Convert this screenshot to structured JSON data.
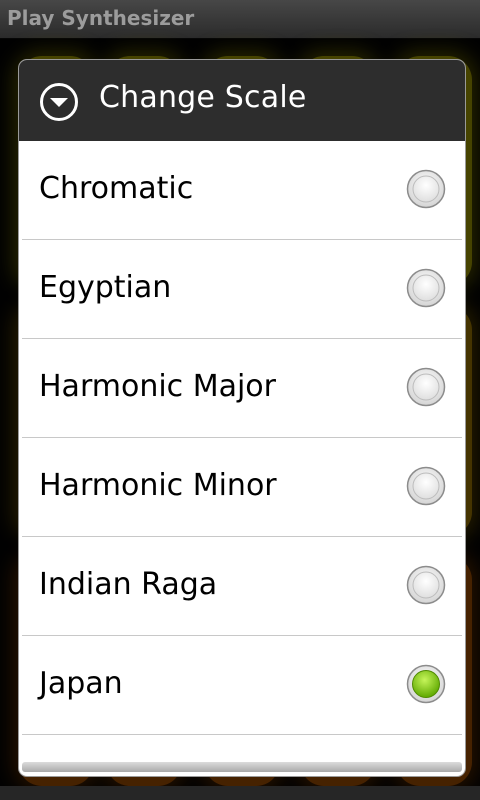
{
  "window": {
    "title": "Play Synthesizer"
  },
  "dialog": {
    "title": "Change Scale",
    "icon": "chevron-down-circle-icon",
    "options": [
      {
        "label": "Chromatic",
        "selected": false
      },
      {
        "label": "Egyptian",
        "selected": false
      },
      {
        "label": "Harmonic Major",
        "selected": false
      },
      {
        "label": "Harmonic Minor",
        "selected": false
      },
      {
        "label": "Indian Raga",
        "selected": false
      },
      {
        "label": "Japan",
        "selected": true
      }
    ]
  },
  "colors": {
    "accent_selected": "#7fcf00",
    "dialog_header": "#2d2d2d",
    "pad_yellow": "#b9b000",
    "pad_orange": "#b85a00"
  }
}
